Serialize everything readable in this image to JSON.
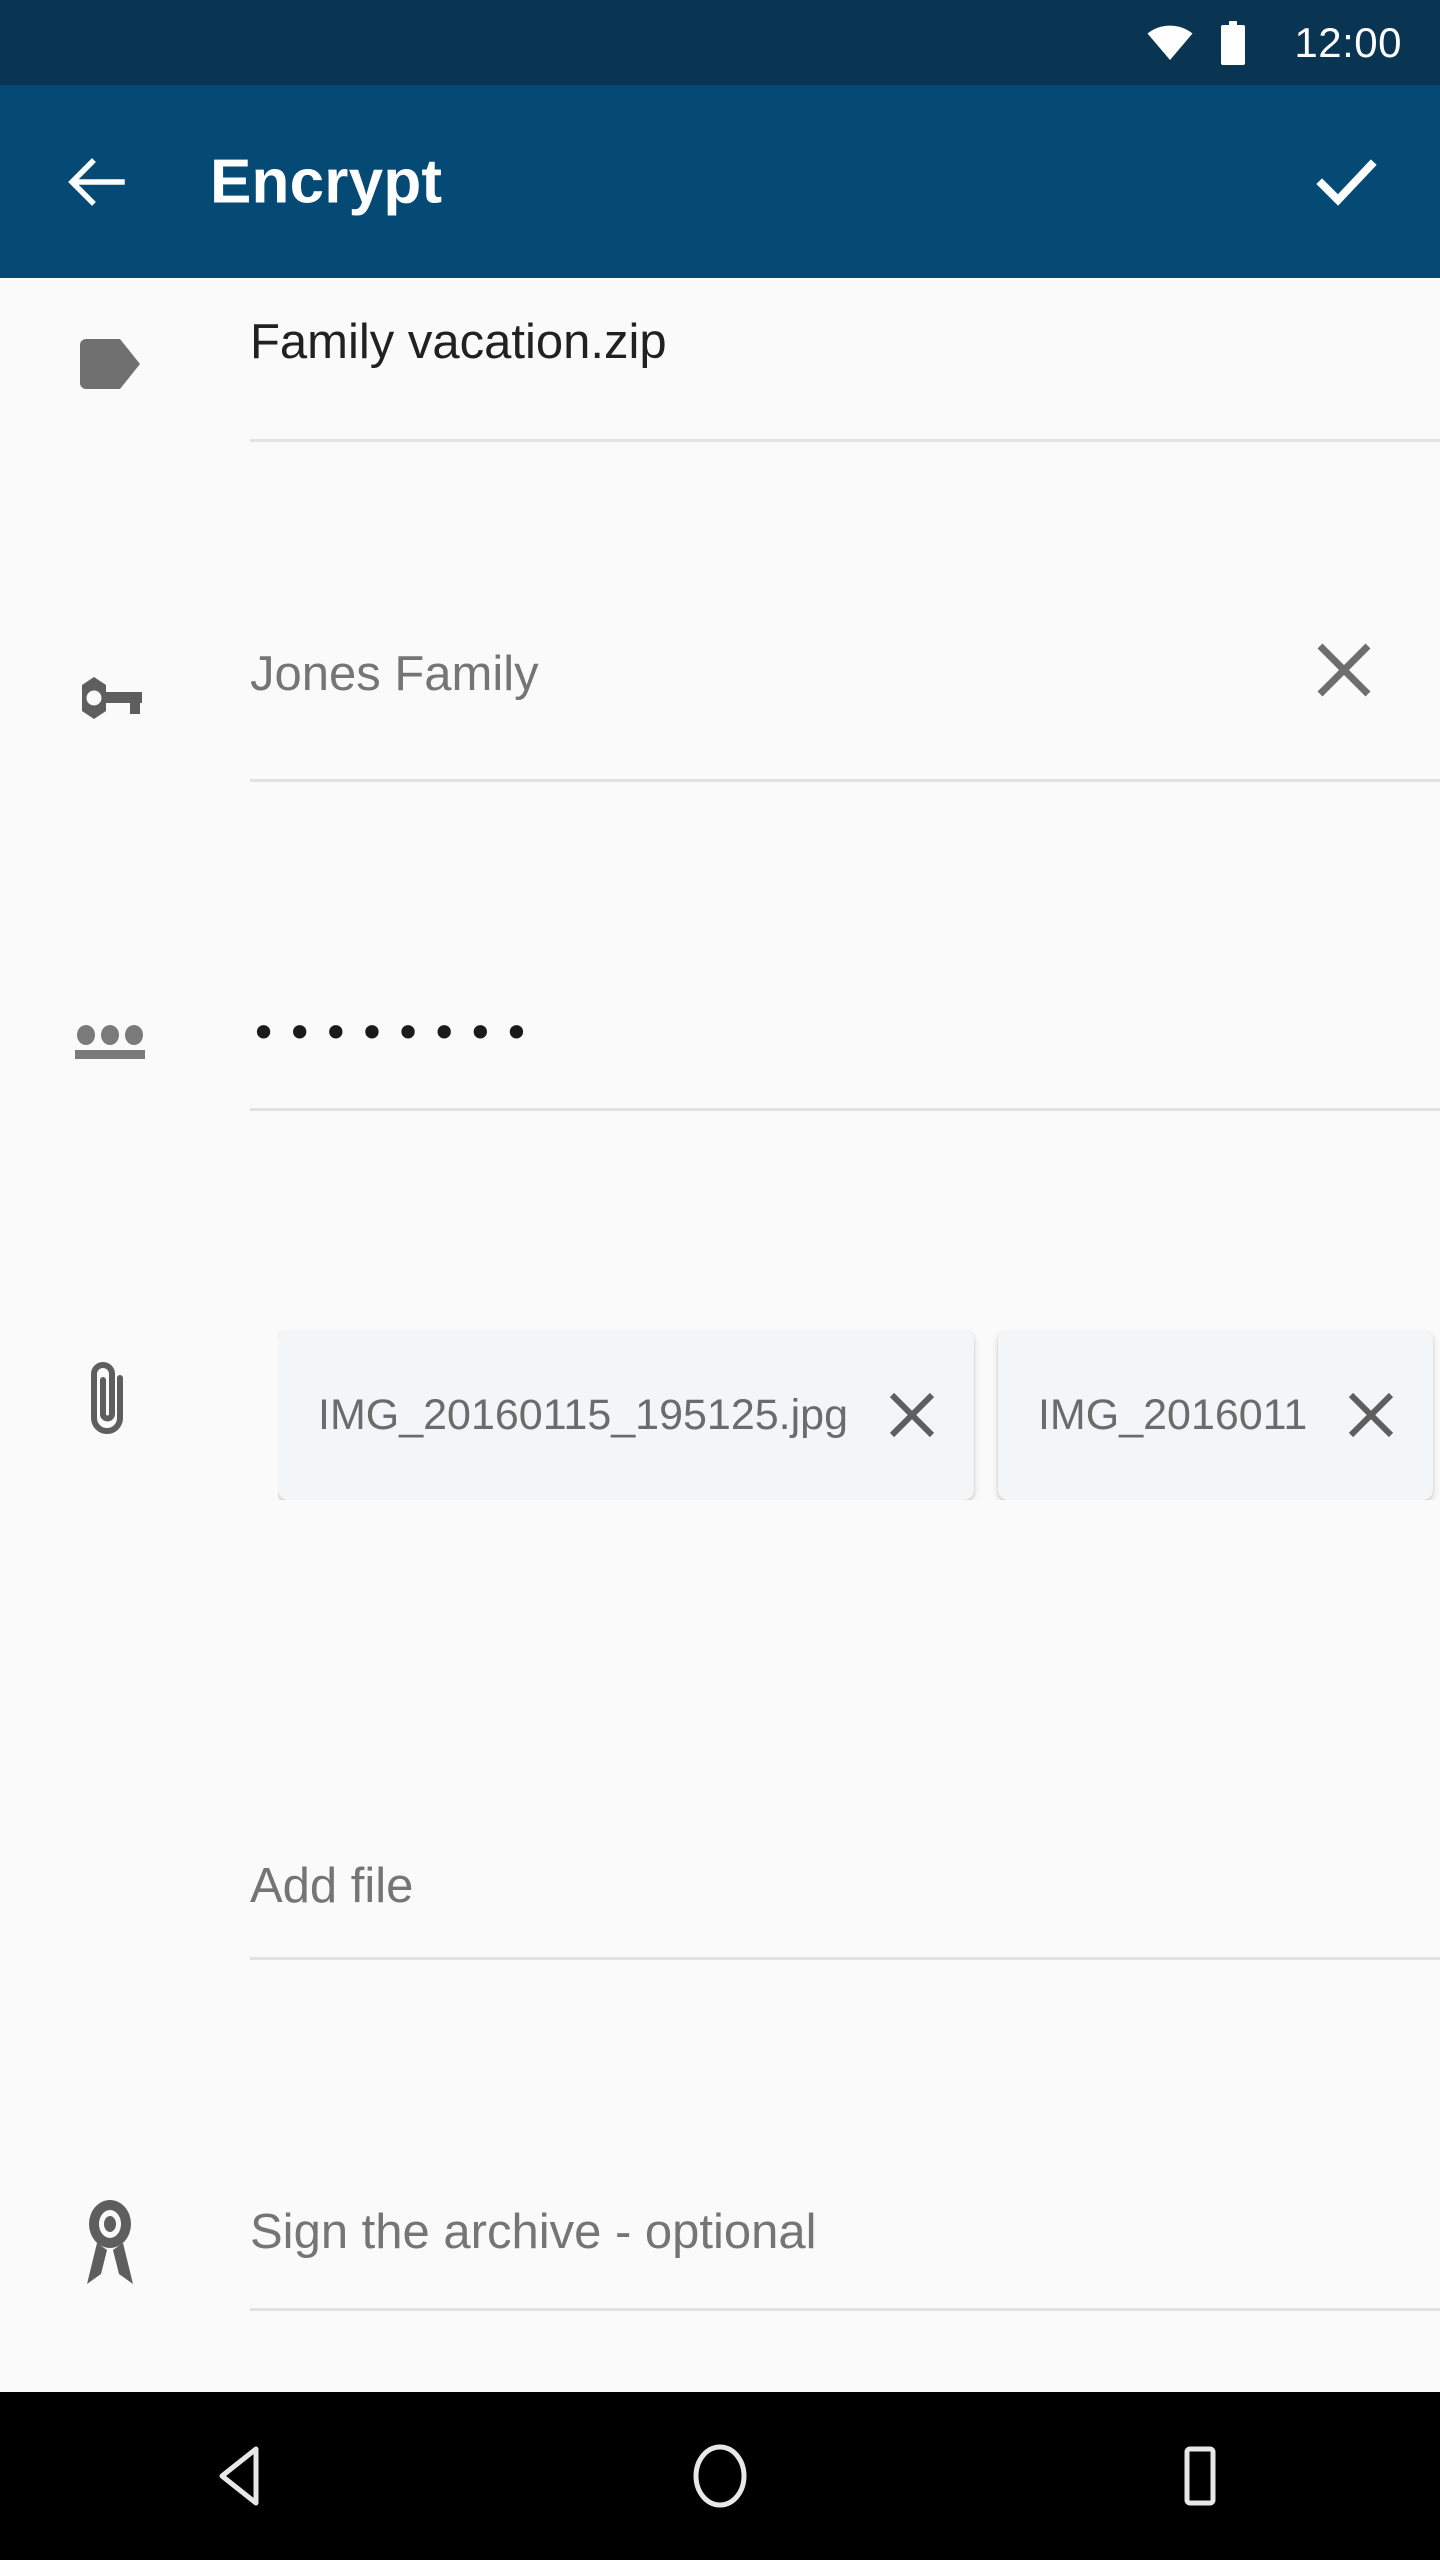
{
  "status_bar": {
    "time": "12:00",
    "wifi_icon": "wifi-icon",
    "battery_icon": "battery-full-icon",
    "background_color": "#0a3552"
  },
  "app_bar": {
    "title": "Encrypt",
    "back_icon": "arrow-back-icon",
    "confirm_icon": "check-icon",
    "background_color": "#044a74",
    "text_color": "#ffffff"
  },
  "form": {
    "rows": [
      {
        "id": "archive-name",
        "icon": "tag-icon",
        "value": "Family vacation.zip",
        "state": "filled"
      },
      {
        "id": "recipient-key",
        "icon": "key-icon",
        "value": "Jones Family",
        "state": "placeholder",
        "clear_icon": "close-icon"
      },
      {
        "id": "password",
        "icon": "password-dots-icon",
        "value": "••••••••",
        "state": "filled"
      },
      {
        "id": "attachments",
        "icon": "attachment-icon",
        "chips": [
          {
            "label": "IMG_20160115_195125.jpg",
            "close_icon": "close-icon"
          },
          {
            "label": "IMG_2016011",
            "close_icon": "close-icon"
          }
        ]
      },
      {
        "id": "add-file",
        "icon": "",
        "value": "Add file",
        "state": "placeholder"
      },
      {
        "id": "signature",
        "icon": "award-icon",
        "value": "Sign the archive - optional",
        "state": "placeholder"
      }
    ],
    "background_color": "#fafafa",
    "divider_color": "#e2e2e2",
    "filled_text_color": "#212121",
    "placeholder_text_color": "#757575"
  },
  "nav_bar": {
    "background_color": "#000000",
    "buttons": [
      {
        "id": "back",
        "icon": "nav-back-triangle-icon"
      },
      {
        "id": "home",
        "icon": "nav-home-circle-icon"
      },
      {
        "id": "recents",
        "icon": "nav-recents-square-icon"
      }
    ]
  }
}
